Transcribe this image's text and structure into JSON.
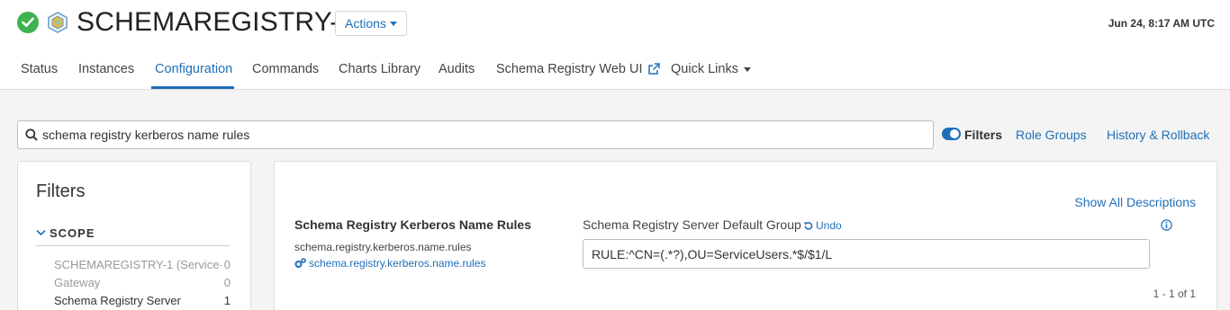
{
  "header": {
    "service_name": "SCHEMAREGISTRY-1",
    "actions_label": "Actions",
    "timestamp": "Jun 24, 8:17 AM UTC",
    "status_icon": "check-circle-icon",
    "service_icon": "schema-registry-hexagon-icon"
  },
  "tabs": [
    {
      "label": "Status"
    },
    {
      "label": "Instances"
    },
    {
      "label": "Configuration",
      "active": true
    },
    {
      "label": "Commands"
    },
    {
      "label": "Charts Library"
    },
    {
      "label": "Audits"
    },
    {
      "label": "Schema Registry Web UI",
      "icon": "external-link-icon"
    },
    {
      "label": "Quick Links",
      "icon": "caret-down-icon"
    }
  ],
  "search": {
    "value": "schema registry kerberos name rules",
    "icon": "search-icon"
  },
  "toolbar": {
    "filters_label": "Filters",
    "filters_enabled": true,
    "role_groups_label": "Role Groups",
    "history_label": "History & Rollback"
  },
  "filters_panel": {
    "title": "Filters",
    "scope_label": "SCOPE",
    "scope_items": [
      {
        "name": "SCHEMAREGISTRY-1 (Service-...",
        "count": "0"
      },
      {
        "name": "Gateway",
        "count": "0"
      },
      {
        "name": "Schema Registry Server",
        "count": "1"
      }
    ]
  },
  "config": {
    "show_all_label": "Show All Descriptions",
    "property_display_name": "Schema Registry Kerberos Name Rules",
    "property_key": "schema.registry.kerberos.name.rules",
    "property_link": "schema.registry.kerberos.name.rules",
    "group_label": "Schema Registry Server Default Group",
    "undo_label": "Undo",
    "value": "RULE:^CN=(.*?),OU=ServiceUsers.*$/$1/L",
    "pagination": "1 - 1 of 1"
  },
  "colors": {
    "accent": "#1f6fb8",
    "success": "#3fb34f",
    "background": "#f4f4f4"
  }
}
